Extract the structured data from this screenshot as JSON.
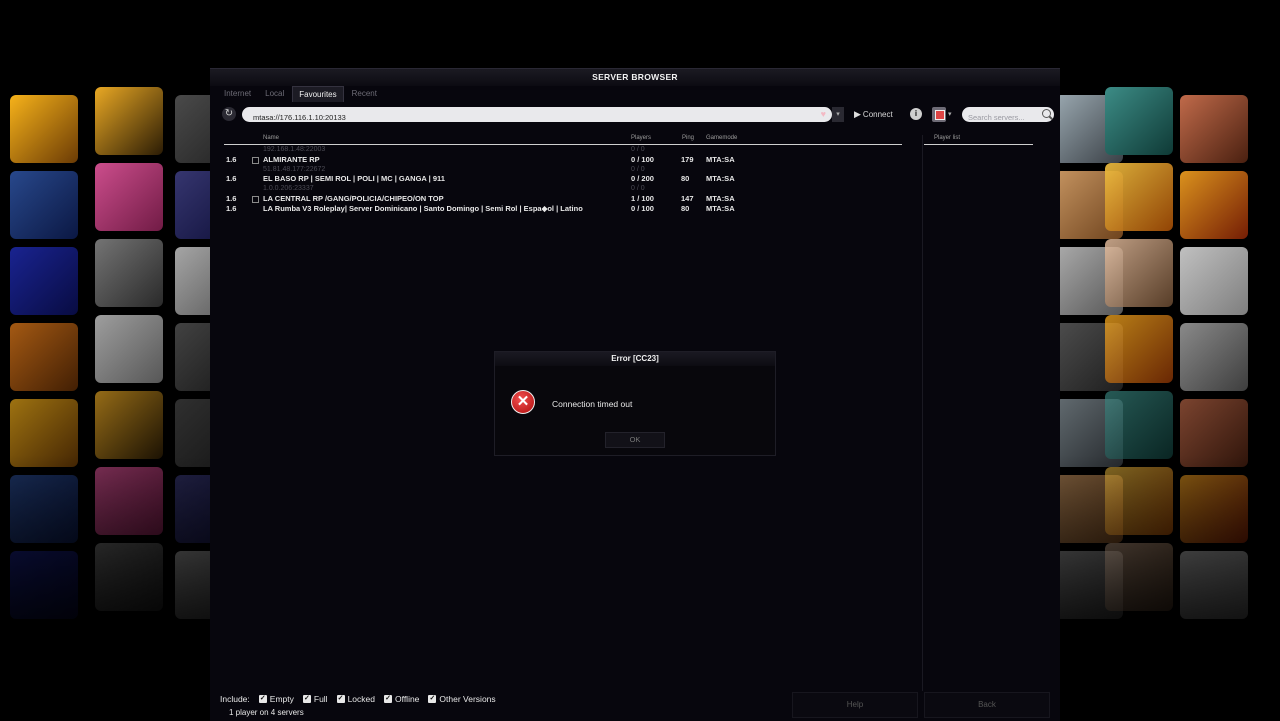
{
  "window": {
    "title": "SERVER BROWSER"
  },
  "tabs": [
    {
      "label": "Internet",
      "active": false
    },
    {
      "label": "Local",
      "active": false
    },
    {
      "label": "Favourites",
      "active": true
    },
    {
      "label": "Recent",
      "active": false
    }
  ],
  "toolbar": {
    "address": "mtasa://176.116.1.10:20133",
    "connect_label": "Connect",
    "search_placeholder": "Search servers...",
    "info_label": "i"
  },
  "list": {
    "headers": {
      "name": "Name",
      "players": "Players",
      "ping": "Ping",
      "gamemode": "Gamemode"
    },
    "rows": [
      {
        "version": "",
        "name": "192.168.1.48:22003",
        "players": "0 / 0",
        "ping": "",
        "gamemode": "",
        "locked": false,
        "offline": true
      },
      {
        "version": "1.6",
        "name": "ALMIRANTE RP",
        "players": "0 / 100",
        "ping": "179",
        "gamemode": "MTA:SA",
        "locked": true,
        "offline": false
      },
      {
        "version": "",
        "name": "51.81.48.177:22672",
        "players": "0 / 0",
        "ping": "",
        "gamemode": "",
        "locked": false,
        "offline": true
      },
      {
        "version": "1.6",
        "name": "EL BASO RP | SEMI ROL | POLI | MC | GANGA | 911",
        "players": "0 / 200",
        "ping": "80",
        "gamemode": "MTA:SA",
        "locked": false,
        "offline": false
      },
      {
        "version": "",
        "name": "1.0.0.206:23337",
        "players": "0 / 0",
        "ping": "",
        "gamemode": "",
        "locked": false,
        "offline": true
      },
      {
        "version": "1.6",
        "name": "LA CENTRAL RP  /GANG/POLICIA/CHIPEO/ON TOP",
        "players": "1 / 100",
        "ping": "147",
        "gamemode": "MTA:SA",
        "locked": true,
        "offline": false
      },
      {
        "version": "1.6",
        "name": "LA Rumba V3  Roleplay| Server Dominicano | Santo Domingo | Semi Rol | Espa◆ol | Latino",
        "players": "0 / 100",
        "ping": "80",
        "gamemode": "MTA:SA",
        "locked": false,
        "offline": false
      }
    ]
  },
  "player_list": {
    "header": "Player list"
  },
  "dialog": {
    "title": "Error [CC23]",
    "message": "Connection timed out",
    "ok_label": "OK",
    "icon_glyph": "✕"
  },
  "bottom": {
    "include_label": "Include:",
    "filters": [
      {
        "label": "Empty",
        "checked": true
      },
      {
        "label": "Full",
        "checked": true
      },
      {
        "label": "Locked",
        "checked": true
      },
      {
        "label": "Offline",
        "checked": true
      },
      {
        "label": "Other Versions",
        "checked": true
      }
    ],
    "status": "1 player on 4 servers",
    "help_label": "Help",
    "back_label": "Back"
  },
  "colors": {
    "window_bg": "#07060d",
    "error_red": "#d22020",
    "offline_text": "#4c4b55"
  }
}
